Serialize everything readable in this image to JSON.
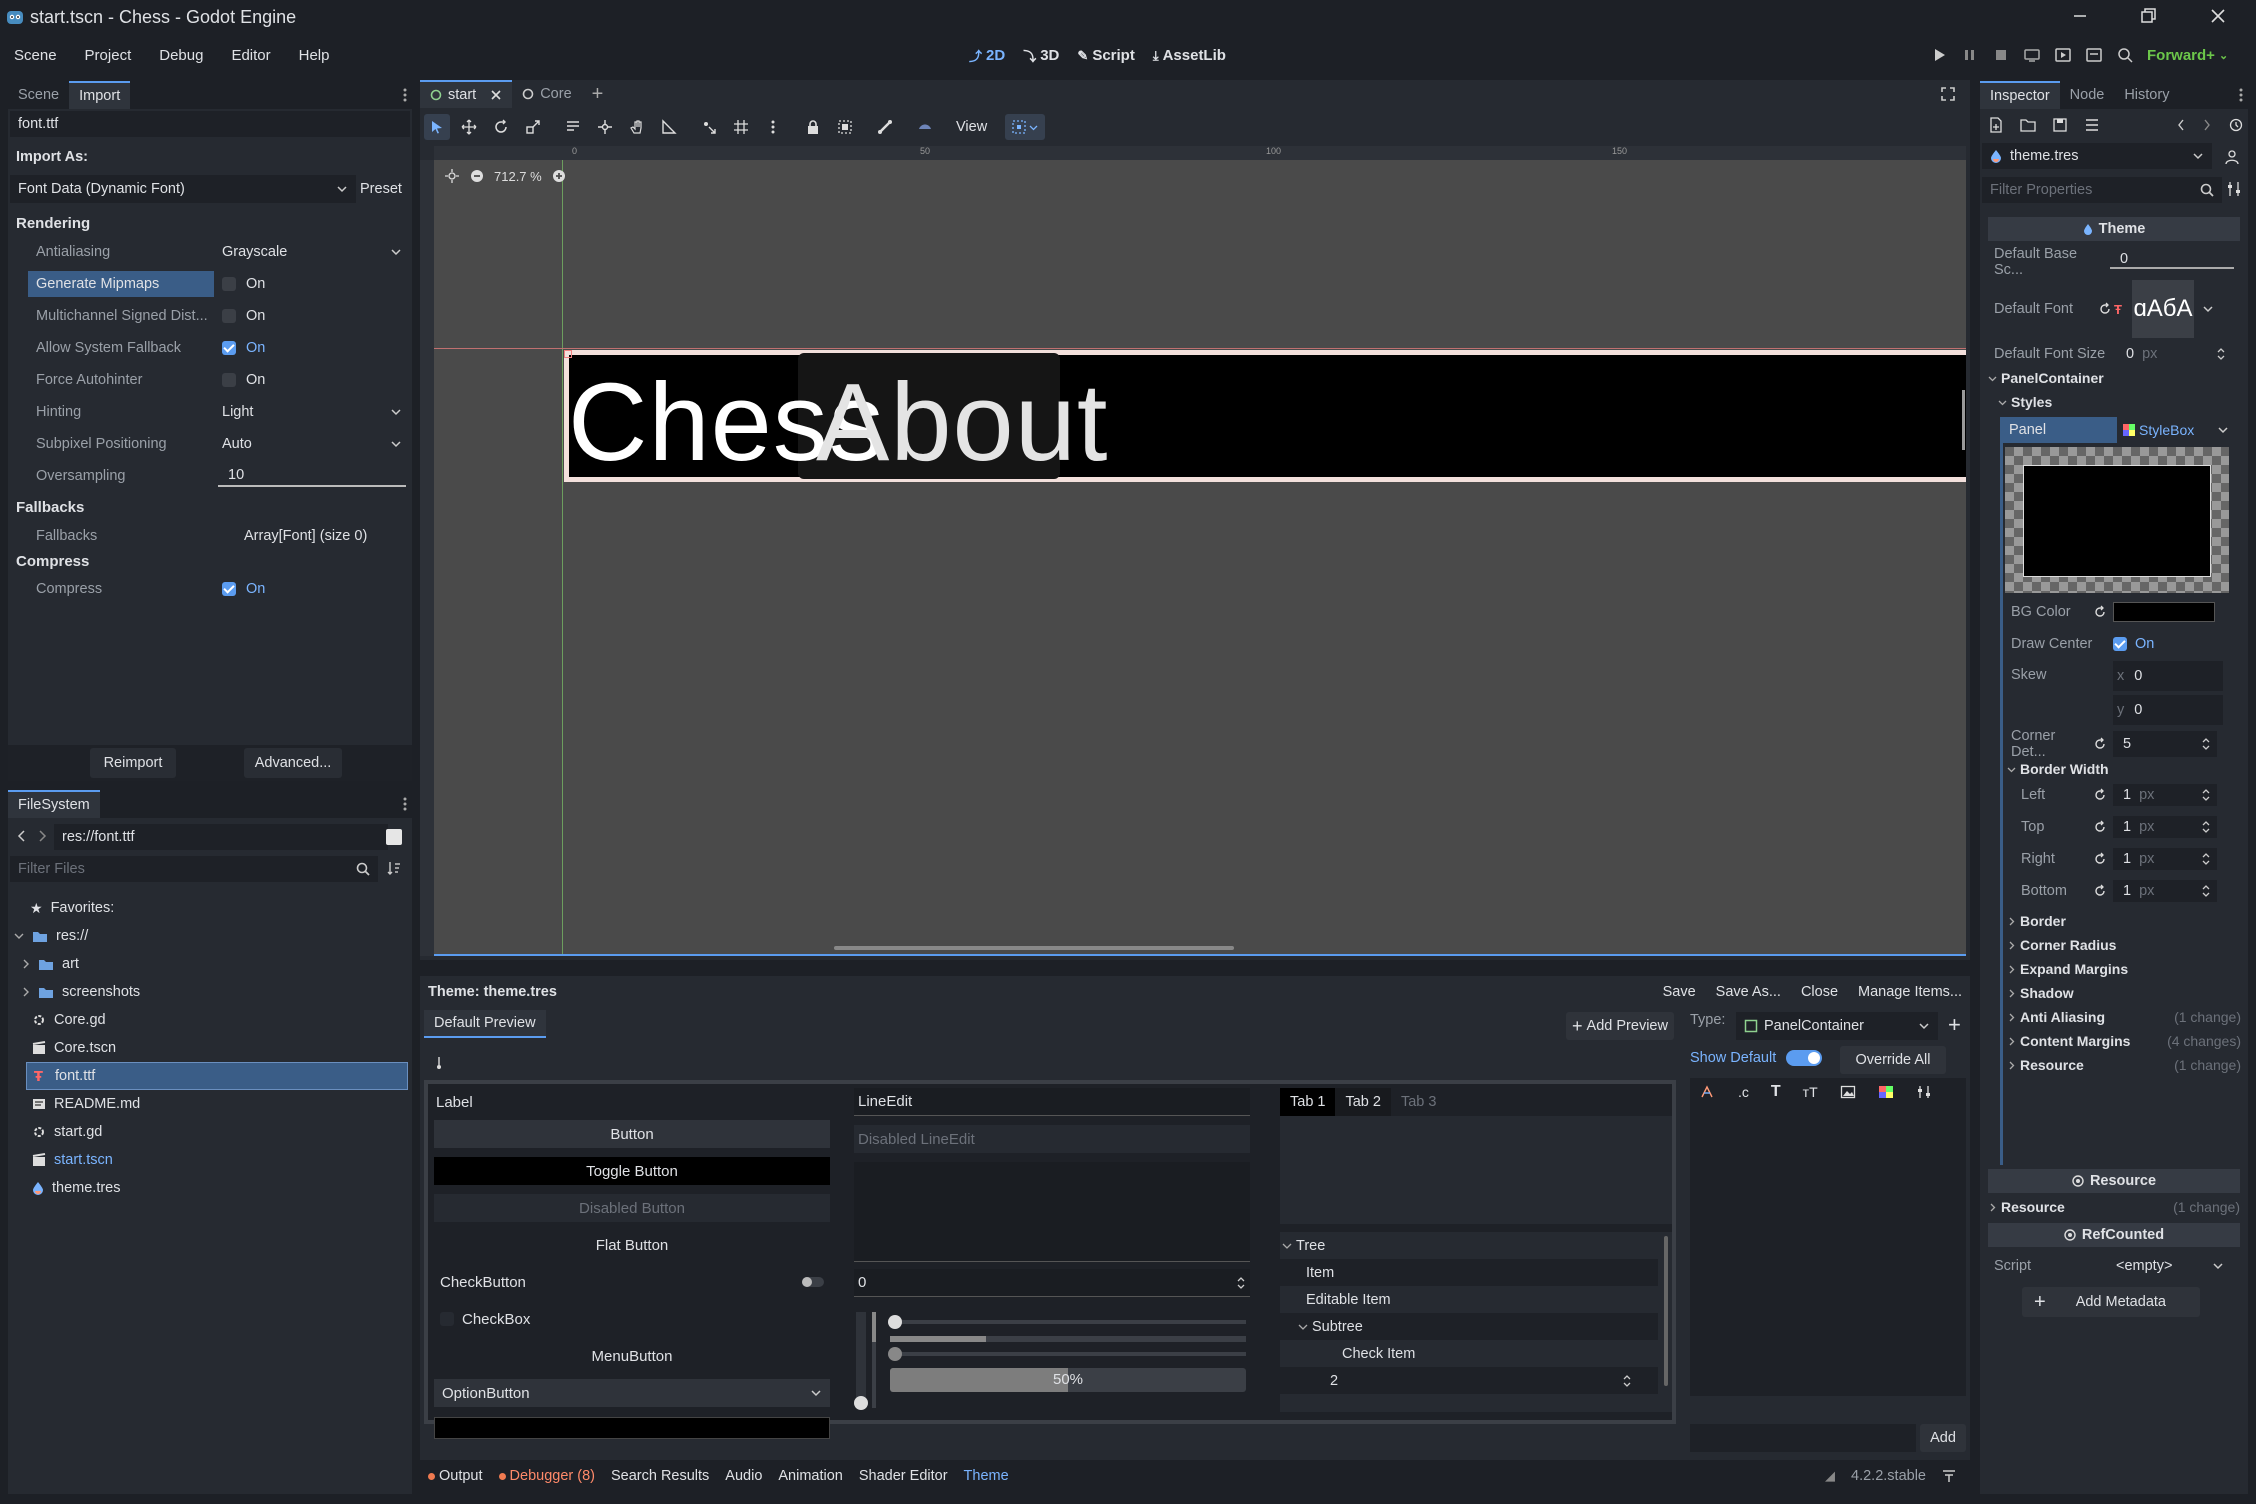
{
  "window": {
    "title": "start.tscn - Chess - Godot Engine",
    "controls": [
      "minimize",
      "restore",
      "close"
    ]
  },
  "menu": {
    "items": [
      "Scene",
      "Project",
      "Debug",
      "Editor",
      "Help"
    ],
    "workspaces": [
      "2D",
      "3D",
      "Script",
      "AssetLib"
    ],
    "renderer": "Forward+"
  },
  "import_dock": {
    "tabs": [
      "Scene",
      "Import"
    ],
    "file": "font.ttf",
    "import_as_label": "Import As:",
    "import_as_value": "Font Data (Dynamic Font)",
    "preset": "Preset",
    "sections": {
      "rendering": "Rendering",
      "fallbacks": "Fallbacks",
      "compress": "Compress"
    },
    "props": {
      "antialiasing": {
        "label": "Antialiasing",
        "value": "Grayscale"
      },
      "mipmaps": {
        "label": "Generate Mipmaps",
        "value": "On"
      },
      "msdf": {
        "label": "Multichannel Signed Dist...",
        "value": "On"
      },
      "sysfallback": {
        "label": "Allow System Fallback",
        "value": "On"
      },
      "autohinter": {
        "label": "Force Autohinter",
        "value": "On"
      },
      "hinting": {
        "label": "Hinting",
        "value": "Light"
      },
      "subpixel": {
        "label": "Subpixel Positioning",
        "value": "Auto"
      },
      "oversampling": {
        "label": "Oversampling",
        "value": "10"
      },
      "fallbacks": {
        "label": "Fallbacks",
        "value": "Array[Font] (size 0)"
      },
      "compress": {
        "label": "Compress",
        "value": "On"
      }
    },
    "reimport": "Reimport",
    "advanced": "Advanced..."
  },
  "filesystem": {
    "title": "FileSystem",
    "path": "res://font.ttf",
    "filter_placeholder": "Filter Files",
    "favorites": "Favorites:",
    "root": "res://",
    "items": [
      {
        "name": "art",
        "type": "folder"
      },
      {
        "name": "screenshots",
        "type": "folder"
      },
      {
        "name": "Core.gd",
        "type": "script"
      },
      {
        "name": "Core.tscn",
        "type": "scene"
      },
      {
        "name": "font.ttf",
        "type": "font",
        "selected": true
      },
      {
        "name": "README.md",
        "type": "text"
      },
      {
        "name": "start.gd",
        "type": "script"
      },
      {
        "name": "start.tscn",
        "type": "scene"
      },
      {
        "name": "theme.tres",
        "type": "resource"
      }
    ]
  },
  "scene_tabs": [
    "start",
    "Core"
  ],
  "viewport": {
    "view_label": "View",
    "zoom": "712.7 %",
    "ruler_marks": [
      "0",
      "50",
      "100",
      "150"
    ],
    "text_left": "Chess",
    "text_right": "About"
  },
  "theme_editor": {
    "title": "Theme: theme.tres",
    "actions": [
      "Save",
      "Save As...",
      "Close",
      "Manage Items..."
    ],
    "preview_tab": "Default Preview",
    "add_preview": "Add Preview",
    "type_label": "Type:",
    "type_value": "PanelContainer",
    "show_default": "Show Default",
    "override_all": "Override All",
    "add": "Add",
    "preview": {
      "label": "Label",
      "button": "Button",
      "toggle_button": "Toggle Button",
      "disabled_button": "Disabled Button",
      "flat_button": "Flat Button",
      "check_button": "CheckButton",
      "check_box": "CheckBox",
      "menu_button": "MenuButton",
      "option_button": "OptionButton",
      "line_edit": "LineEdit",
      "disabled_line_edit": "Disabled LineEdit",
      "spin_value": "0",
      "progress": "50%",
      "progress_value": 0.5,
      "tabs": [
        "Tab 1",
        "Tab 2",
        "Tab 3"
      ],
      "tree": [
        "Tree",
        "Item",
        "Editable Item",
        "Subtree",
        "Check Item",
        "2"
      ]
    }
  },
  "bottom_bar": {
    "tabs": [
      "Output",
      "Debugger (8)",
      "Search Results",
      "Audio",
      "Animation",
      "Shader Editor",
      "Theme"
    ],
    "version": "4.2.2.stable"
  },
  "inspector": {
    "tabs": [
      "Inspector",
      "Node",
      "History"
    ],
    "resource": "theme.tres",
    "filter_placeholder": "Filter Properties",
    "header": "Theme",
    "default_base_scale": {
      "label": "Default Base Sc...",
      "value": "0"
    },
    "default_font": {
      "label": "Default Font",
      "preview": "ɑАбА"
    },
    "default_font_size": {
      "label": "Default Font Size",
      "value": "0",
      "unit": "px"
    },
    "panel_container": "PanelContainer",
    "styles": "Styles",
    "panel": "Panel",
    "stylebox": "StyleBox",
    "bg_color": "BG Color",
    "draw_center": {
      "label": "Draw Center",
      "value": "On"
    },
    "skew": {
      "label": "Skew",
      "x": "0",
      "y": "0"
    },
    "corner_detail": {
      "label": "Corner Det...",
      "value": "5"
    },
    "border_width": "Border Width",
    "borders": [
      {
        "label": "Left",
        "value": "1",
        "unit": "px"
      },
      {
        "label": "Top",
        "value": "1",
        "unit": "px"
      },
      {
        "label": "Right",
        "value": "1",
        "unit": "px"
      },
      {
        "label": "Bottom",
        "value": "1",
        "unit": "px"
      }
    ],
    "groups": [
      {
        "label": "Border",
        "note": ""
      },
      {
        "label": "Corner Radius",
        "note": ""
      },
      {
        "label": "Expand Margins",
        "note": ""
      },
      {
        "label": "Shadow",
        "note": ""
      },
      {
        "label": "Anti Aliasing",
        "note": "(1 change)"
      },
      {
        "label": "Content Margins",
        "note": "(4 changes)"
      },
      {
        "label": "Resource",
        "note": "(1 change)"
      }
    ],
    "resource_header": "Resource",
    "resource_group": {
      "label": "Resource",
      "note": "(1 change)"
    },
    "refcounted": "RefCounted",
    "script": {
      "label": "Script",
      "value": "<empty>"
    },
    "add_metadata": "Add Metadata"
  },
  "colors": {
    "accent": "#5b9cf0",
    "bg": "#1d2026",
    "panel": "#262a31",
    "viewport": "#4a4a4a",
    "debugger": "#ff8a6a",
    "output_dot": "#f07a50",
    "renderer": "#6cc64a"
  }
}
